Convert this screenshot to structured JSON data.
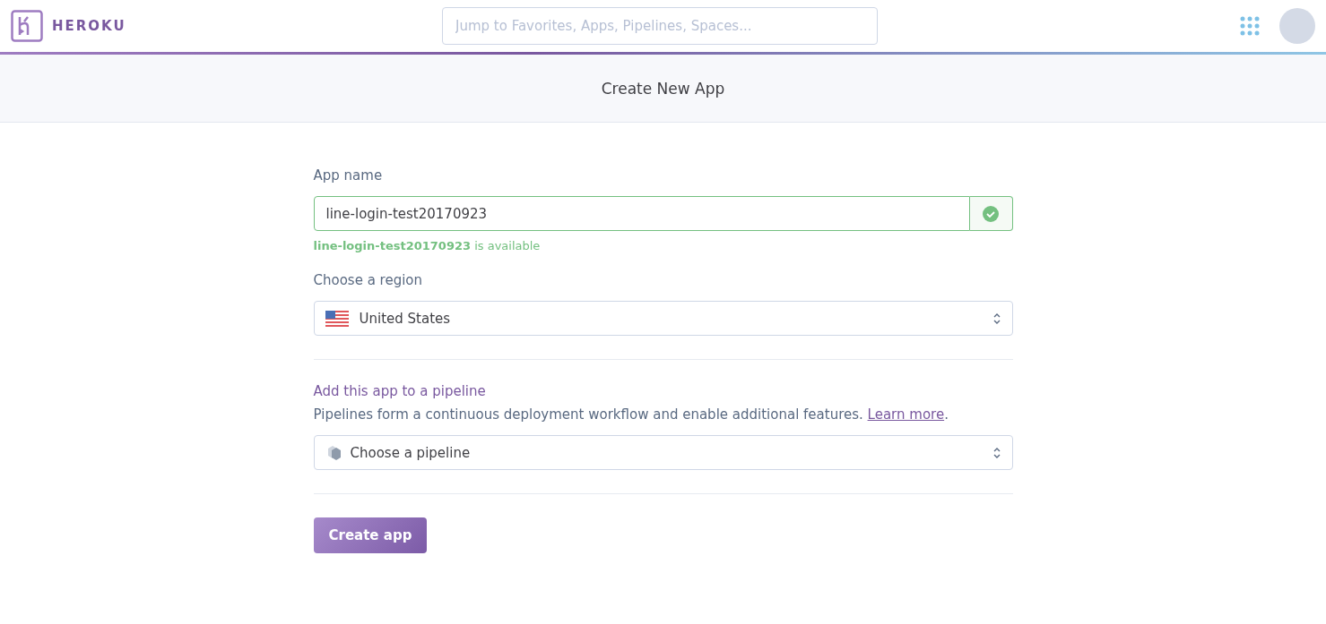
{
  "header": {
    "brand": "HEROKU",
    "search": {
      "placeholder": "Jump to Favorites, Apps, Pipelines, Spaces..."
    }
  },
  "page_title": "Create New App",
  "form": {
    "app_name": {
      "label": "App name",
      "value": "line-login-test20170923",
      "valid": true,
      "message": "**line-login-test20170923** is available"
    },
    "region": {
      "label": "Choose a region",
      "value": "United States"
    },
    "pipeline": {
      "heading": "Add this app to a pipeline",
      "description": "Pipelines form a continuous deployment workflow and enable additional features. ",
      "link": "Learn more",
      "suffix": ".",
      "placeholder": "Choose a pipeline"
    },
    "submit": "Create app"
  }
}
